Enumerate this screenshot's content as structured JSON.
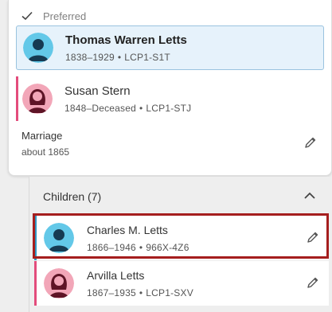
{
  "preferred": {
    "label": "Preferred"
  },
  "father": {
    "name": "Thomas Warren Letts",
    "lifespan": "1838–1929",
    "id": "LCP1-S1T"
  },
  "mother": {
    "name": "Susan Stern",
    "lifespan": "1848–Deceased",
    "id": "LCP1-STJ"
  },
  "marriage": {
    "title": "Marriage",
    "date": "about 1865"
  },
  "children": {
    "header": "Children (7)",
    "items": [
      {
        "name": "Charles M. Letts",
        "lifespan": "1866–1946",
        "id": "966X-4Z6",
        "gender": "male"
      },
      {
        "name": "Arvilla Letts",
        "lifespan": "1867–1935",
        "id": "LCP1-SXV",
        "gender": "female"
      }
    ]
  },
  "separator": "•",
  "icons": {
    "check": "check-icon",
    "pencil": "pencil-icon",
    "collapse": "chevron-up-icon",
    "male_avatar": "male-avatar-icon",
    "female_avatar": "female-avatar-icon"
  },
  "colors": {
    "male": "#2e98c4",
    "female": "#e34c7c",
    "selection": "#a51e1e",
    "highlight_bg": "#e6f2fb",
    "highlight_border": "#9ac3df"
  }
}
